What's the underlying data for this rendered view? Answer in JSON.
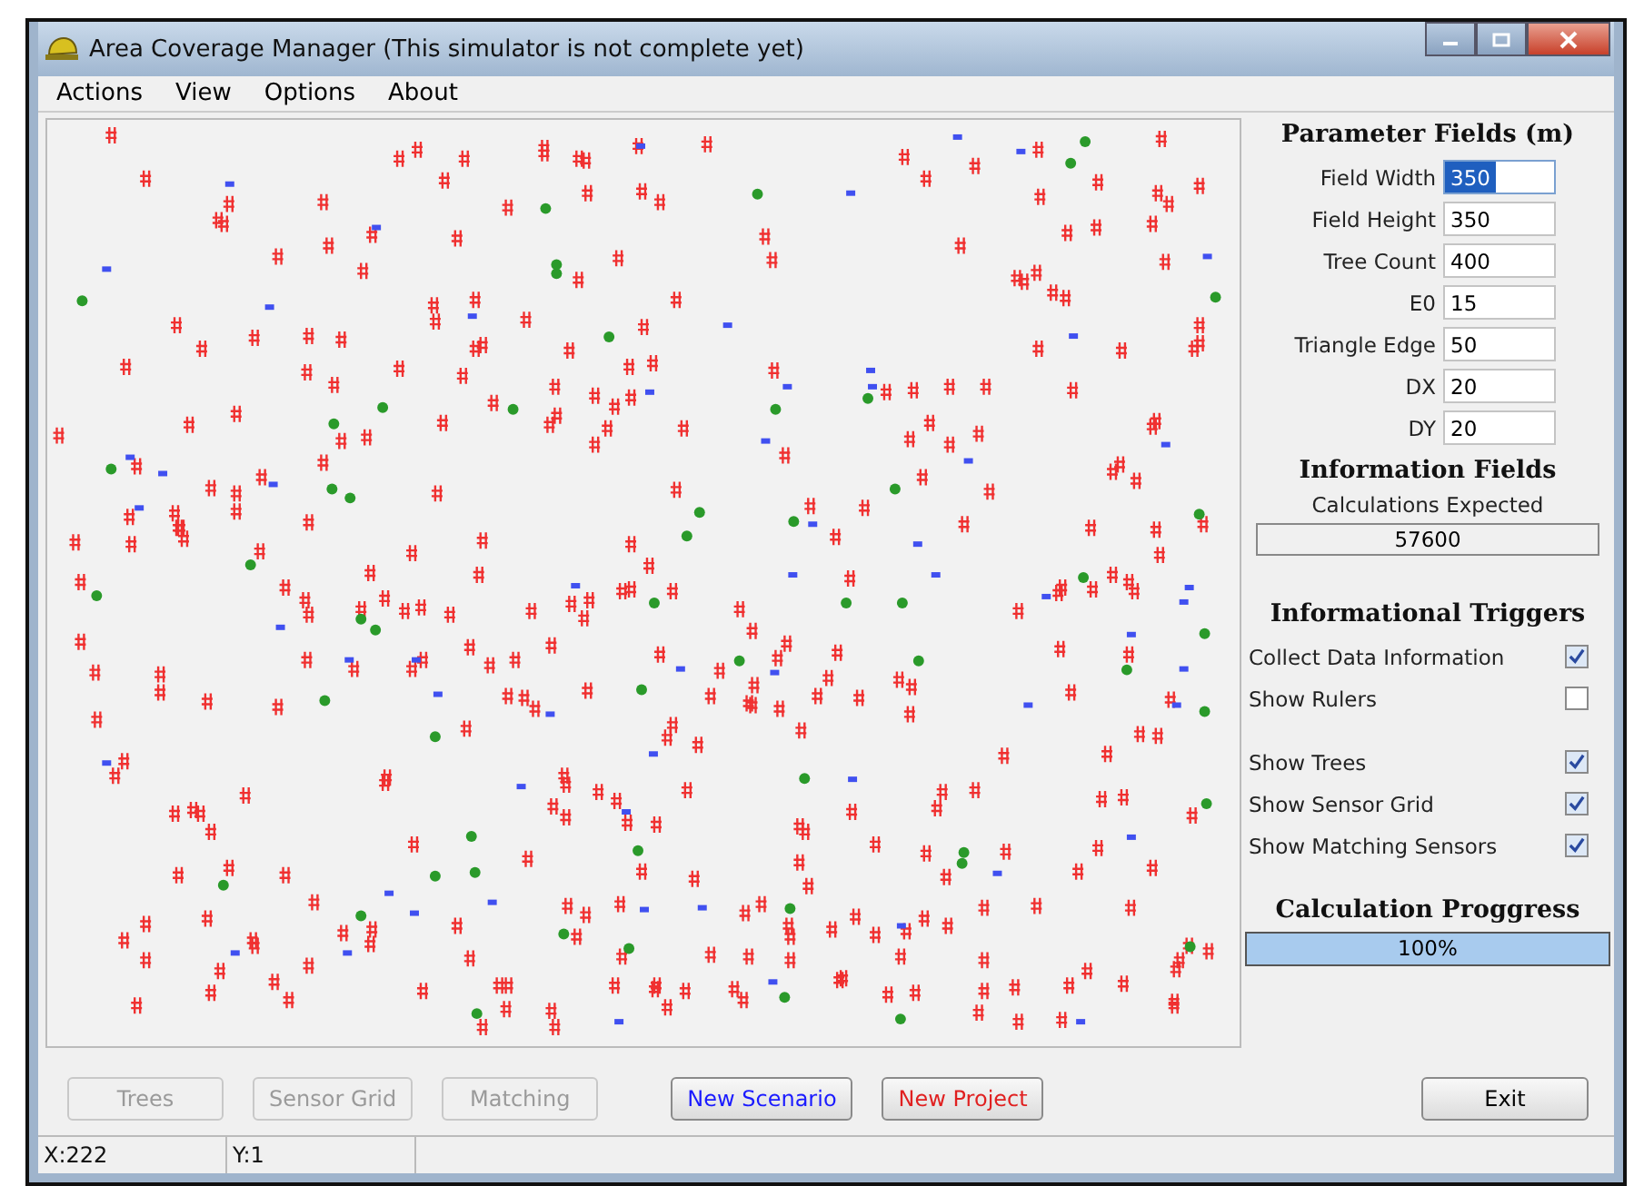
{
  "window": {
    "title": "Area Coverage Manager (This simulator is not complete yet)"
  },
  "menu": [
    "Actions",
    "View",
    "Options",
    "About"
  ],
  "parameters": {
    "title": "Parameter Fields (m)",
    "fields": [
      {
        "label": "Field Width",
        "value": "350",
        "selected": true
      },
      {
        "label": "Field Height",
        "value": "350",
        "selected": false
      },
      {
        "label": "Tree Count",
        "value": "400",
        "selected": false
      },
      {
        "label": "E0",
        "value": "15",
        "selected": false
      },
      {
        "label": "Triangle Edge",
        "value": "50",
        "selected": false
      },
      {
        "label": "DX",
        "value": "20",
        "selected": false
      },
      {
        "label": "DY",
        "value": "20",
        "selected": false
      }
    ]
  },
  "information": {
    "title": "Information Fields",
    "label": "Calculations Expected",
    "value": "57600"
  },
  "triggers": {
    "title": "Informational Triggers",
    "groups": [
      [
        {
          "label": "Collect Data Information",
          "checked": true
        },
        {
          "label": "Show Rulers",
          "checked": false
        }
      ],
      [
        {
          "label": "Show Trees",
          "checked": true
        },
        {
          "label": "Show Sensor Grid",
          "checked": true
        },
        {
          "label": "Show Matching Sensors",
          "checked": true
        }
      ]
    ]
  },
  "progress": {
    "title": "Calculation Proggress",
    "level": 1,
    "reading": "100%"
  },
  "buttons": [
    {
      "label": "Trees",
      "disabled": true
    },
    {
      "label": "Sensor Grid",
      "disabled": true
    },
    {
      "label": "Matching",
      "disabled": true
    },
    {
      "label": "New Scenario",
      "disabled": false,
      "color": "#1a1aff"
    },
    {
      "label": "New Project",
      "disabled": false,
      "color": "#e02020"
    },
    {
      "label": "Exit",
      "disabled": false,
      "color": "#000000"
    }
  ],
  "status_bar": [
    "X:222",
    "Y:1"
  ]
}
